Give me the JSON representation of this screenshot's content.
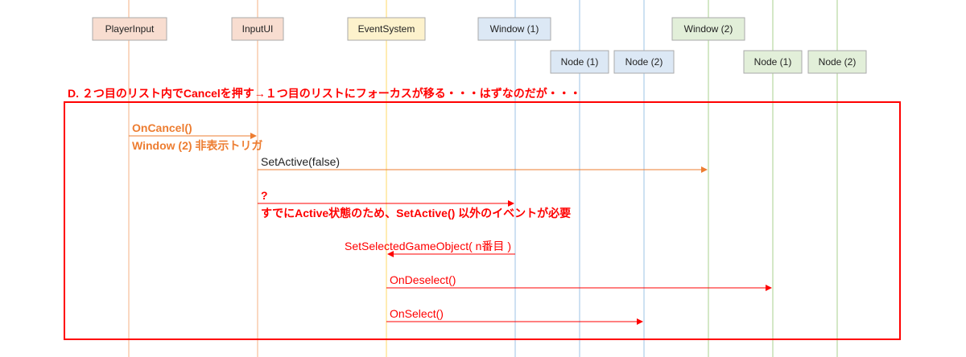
{
  "participants": [
    {
      "id": "p_player",
      "label": "PlayerInput"
    },
    {
      "id": "p_inputui",
      "label": "InputUI"
    },
    {
      "id": "p_eventsys",
      "label": "EventSystem"
    },
    {
      "id": "p_window1",
      "label": "Window (1)"
    },
    {
      "id": "p_w1node1",
      "label": "Node (1)"
    },
    {
      "id": "p_w1node2",
      "label": "Node (2)"
    },
    {
      "id": "p_window2",
      "label": "Window (2)"
    },
    {
      "id": "p_w2node1",
      "label": "Node (1)"
    },
    {
      "id": "p_w2node2",
      "label": "Node (2)"
    }
  ],
  "colors": {
    "player": "#f8ddd0",
    "inputui": "#f8ddd0",
    "eventsys": "#fdf2cc",
    "window1": "#dce8f5",
    "window2": "#e2efd9",
    "frame": "#ff0000",
    "orange": "#ed7d31",
    "red": "#ff0000",
    "blue_line": "#9dc3e6",
    "green_line": "#a9d08e",
    "yellow_line": "#ffd966",
    "orange_line": "#f4b183"
  },
  "scenario": {
    "title": "D. ２つ目のリスト内でCancelを押す→１つ目のリストにフォーカスが移る・・・はずなのだが・・・"
  },
  "messages": {
    "m1_line1": "OnCancel()",
    "m1_line2": "Window (2) 非表示トリガ",
    "m2": "SetActive(false)",
    "m3_line1": "?",
    "m3_line2": "すでにActive状態のため、SetActive() 以外のイベントが必要",
    "m4": "SetSelectedGameObject( n番目 )",
    "m5": "OnDeselect()",
    "m6": "OnSelect()"
  }
}
